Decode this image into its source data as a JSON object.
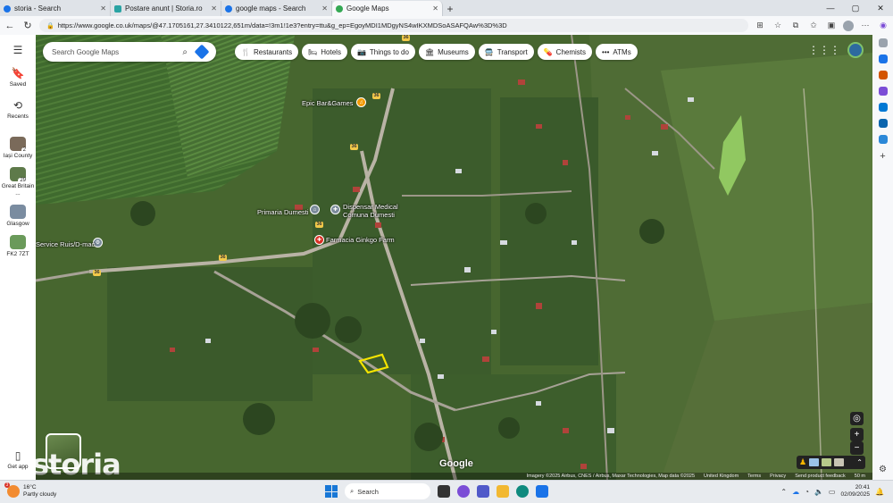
{
  "browser": {
    "tabs": [
      {
        "title": "storia - Search",
        "color": "#1a73e8",
        "active": false
      },
      {
        "title": "Postare anunt | Storia.ro",
        "color": "#29a3a3",
        "active": false
      },
      {
        "title": "google maps - Search",
        "color": "#1a73e8",
        "active": false
      },
      {
        "title": "Google Maps",
        "color": "#34a853",
        "active": true
      }
    ],
    "url": "https://www.google.co.uk/maps/@47.1705161,27.3410122,651m/data=!3m1!1e3?entry=ttu&g_ep=EgoyMDI1MDgyNS4wIKXMDSoASAFQAw%3D%3D"
  },
  "left_rail": {
    "saved": "Saved",
    "recents": "Recents",
    "places": [
      {
        "label": "Iași County",
        "badge": "2",
        "color": "#7a6a5a"
      },
      {
        "label": "Great Britain ...",
        "badge": "29",
        "color": "#5e7a4a"
      },
      {
        "label": "Glasgow",
        "badge": "",
        "color": "#7a8ca0"
      },
      {
        "label": "FK2 7ZT",
        "badge": "",
        "color": "#6a9a5a"
      }
    ],
    "get_app": "Get app"
  },
  "map": {
    "search_placeholder": "Search Google Maps",
    "chips": [
      {
        "label": "Restaurants",
        "icon": "🍴"
      },
      {
        "label": "Hotels",
        "icon": "🛏"
      },
      {
        "label": "Things to do",
        "icon": "📷"
      },
      {
        "label": "Museums",
        "icon": "🏛"
      },
      {
        "label": "Transport",
        "icon": "🚍"
      },
      {
        "label": "Chemists",
        "icon": "💊"
      },
      {
        "label": "ATMs",
        "icon": "•••"
      }
    ],
    "labels": {
      "bar": "Epic Bar&Games",
      "primaria": "Primaria Dumesti",
      "dispensar": "Dispensar Medical\nComuna Dumesti",
      "farmacia": "Farmacia Ginkgo Farm",
      "service": "Service Ruis/D-mac"
    },
    "road_numbers": [
      "36",
      "36",
      "36",
      "36",
      "36",
      "36"
    ],
    "layers_label": "Layers",
    "watermark": "storia",
    "google": "Google",
    "footer": [
      "Imagery ©2025 Airbus, CNES / Airbus, Maxar Technologies, Map data ©2025",
      "United Kingdom",
      "Terms",
      "Privacy",
      "Send product feedback",
      "50 m"
    ],
    "colors": {
      "bar_pin": "#f29900",
      "farm_pin": "#d93025",
      "poi_pin": "#7a8a9a",
      "parcel": "#f5e400"
    }
  },
  "taskbar": {
    "weather_temp": "16°C",
    "weather_desc": "Partly cloudy",
    "weather_badge": "3",
    "search": "Search",
    "time": "20:41",
    "date": "02/09/2025"
  }
}
